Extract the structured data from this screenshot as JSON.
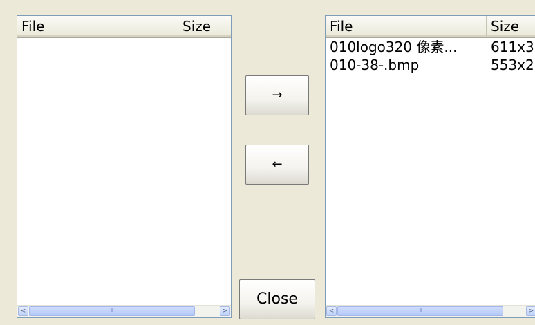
{
  "left_list": {
    "columns": [
      "File",
      "Size"
    ],
    "rows": []
  },
  "right_list": {
    "columns": [
      "File",
      "Size"
    ],
    "rows": [
      {
        "file": "010logo320 像素...",
        "size": "611x3"
      },
      {
        "file": "010-38-.bmp",
        "size": "553x2"
      }
    ]
  },
  "buttons": {
    "move_right": "→",
    "move_left": "←",
    "close": "Close"
  },
  "scrollbar_glyphs": {
    "left": "<",
    "right": ">",
    "grip": "III"
  }
}
